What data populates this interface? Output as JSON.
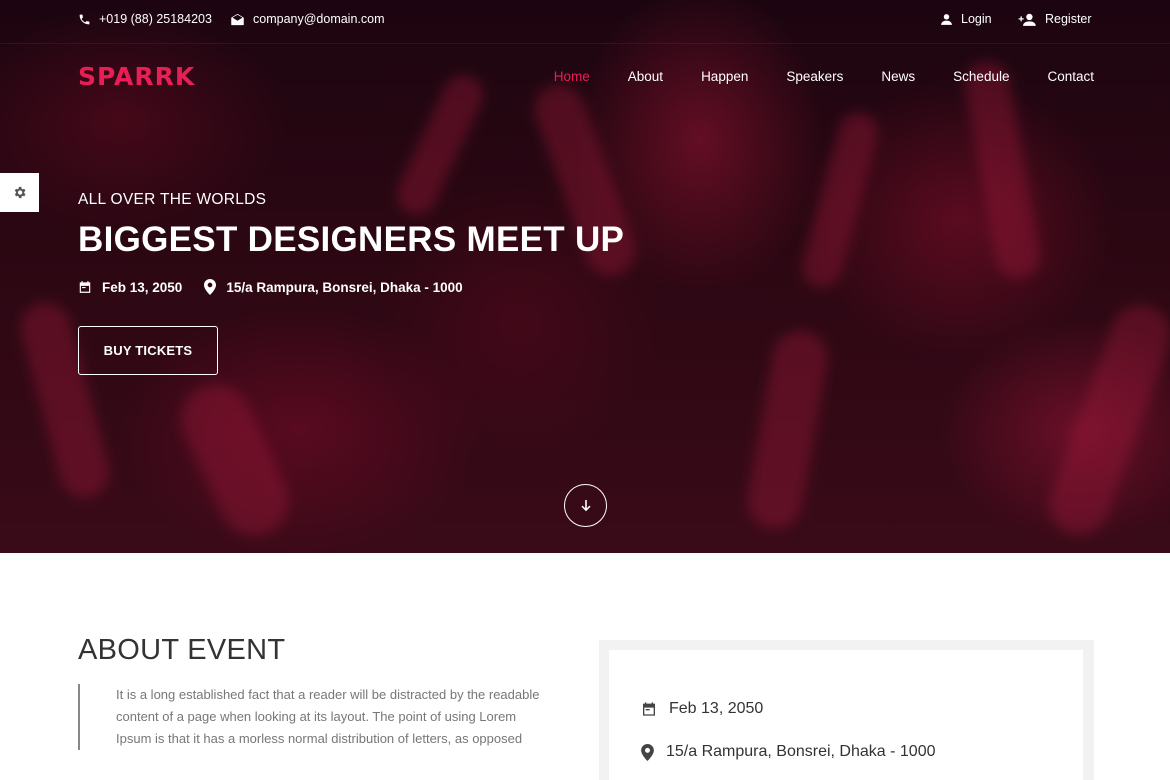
{
  "topbar": {
    "phone": "+019 (88) 25184203",
    "email": "company@domain.com",
    "login": "Login",
    "register": "Register"
  },
  "brand": {
    "logo": "SPARRK",
    "accent_color": "#e91e54"
  },
  "nav": {
    "items": [
      {
        "label": "Home",
        "active": true
      },
      {
        "label": "About"
      },
      {
        "label": "Happen"
      },
      {
        "label": "Speakers"
      },
      {
        "label": "News"
      },
      {
        "label": "Schedule"
      },
      {
        "label": "Contact"
      }
    ]
  },
  "hero": {
    "subtitle": "ALL OVER THE WORLDS",
    "title": "BIGGEST DESIGNERS MEET UP",
    "date": "Feb 13, 2050",
    "location": "15/a Rampura, Bonsrei, Dhaka - 1000",
    "cta": "BUY TICKETS"
  },
  "about": {
    "title": "ABOUT EVENT",
    "text": "It is a long established fact that a reader will be distracted by the readable content of a page when looking at its layout. The point of using Lorem Ipsum is that it has a morless normal distribution of letters, as opposed"
  },
  "info": {
    "date": "Feb 13, 2050",
    "location": "15/a Rampura, Bonsrei, Dhaka - 1000"
  },
  "icons": [
    "phone-icon",
    "envelope-icon",
    "user-icon",
    "user-plus-icon",
    "gear-icon",
    "calendar-icon",
    "map-pin-icon",
    "arrow-down-icon"
  ]
}
